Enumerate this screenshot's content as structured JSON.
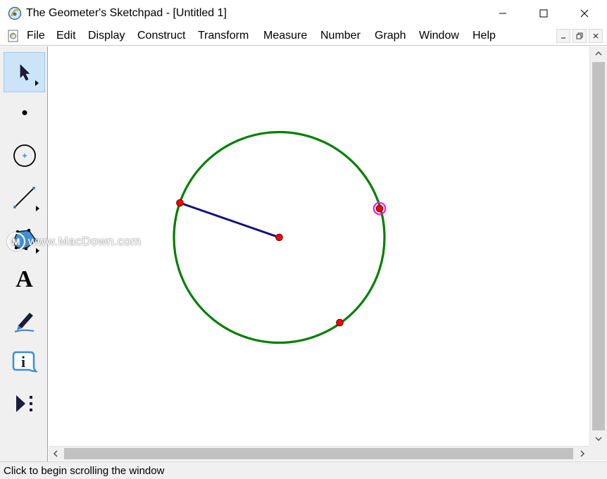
{
  "window": {
    "title": "The Geometer's Sketchpad - [Untitled 1]",
    "minimize_glyph": "—",
    "maximize_glyph": "☐",
    "close_glyph": "✕"
  },
  "menu": {
    "items": [
      "File",
      "Edit",
      "Display",
      "Construct",
      "Transform",
      "Measure",
      "Number",
      "Graph",
      "Window",
      "Help"
    ]
  },
  "toolbox": {
    "tools": [
      {
        "name": "selection-arrow-tool",
        "icon": "arrow-pointer-icon",
        "selected": true
      },
      {
        "name": "point-tool",
        "icon": "point-icon"
      },
      {
        "name": "compass-tool",
        "icon": "circle-icon"
      },
      {
        "name": "straightedge-tool",
        "icon": "line-segment-icon"
      },
      {
        "name": "polygon-tool",
        "icon": "polygon-icon"
      },
      {
        "name": "text-tool",
        "icon": "text-a-icon",
        "glyph": "A"
      },
      {
        "name": "marker-tool",
        "icon": "marker-pen-icon"
      },
      {
        "name": "information-tool",
        "icon": "info-icon",
        "glyph": "i"
      },
      {
        "name": "custom-tool",
        "icon": "play-menu-icon"
      }
    ]
  },
  "sketch": {
    "colors": {
      "circle": "#008000",
      "segment": "#101080",
      "point": "#ff0000",
      "highlight": "#e020e0"
    }
  },
  "watermark": {
    "logo_letter": "M",
    "text": "www.MacDown.com"
  },
  "statusbar": {
    "text": "Click to begin scrolling the window"
  }
}
